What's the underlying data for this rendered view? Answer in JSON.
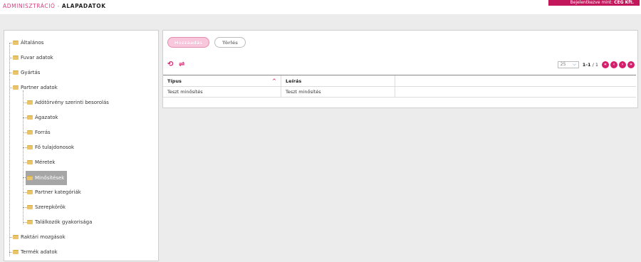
{
  "header": {
    "crumb_admin": "ADMINISZTRÁCIÓ",
    "crumb_sep": "-",
    "crumb_current": "ALAPADATOK",
    "login_prefix": "Bejelentkezve mint:",
    "login_company": "CÉG Kft."
  },
  "tree": {
    "items": [
      {
        "label": "Általános"
      },
      {
        "label": "Fuvar adatok"
      },
      {
        "label": "Gyártás"
      },
      {
        "label": "Partner adatok"
      },
      {
        "label": "Adótörvény szerinti besorolás"
      },
      {
        "label": "Ágazatok"
      },
      {
        "label": "Forrás"
      },
      {
        "label": "Fő tulajdonosok"
      },
      {
        "label": "Méretek"
      },
      {
        "label": "Minősítések"
      },
      {
        "label": "Partner kategóriák"
      },
      {
        "label": "Szerepkörök"
      },
      {
        "label": "Találkozók gyakorisága"
      },
      {
        "label": "Raktári mozgások"
      },
      {
        "label": "Termék adatok"
      }
    ]
  },
  "toolbar": {
    "add_label": "Hozzáadás",
    "delete_label": "Törlés"
  },
  "icons": {
    "refresh": "refresh-icon",
    "swap": "swap-icon"
  },
  "pager": {
    "page_size": "25",
    "range": "1-1",
    "total": "/ 1"
  },
  "table": {
    "columns": [
      "Típus",
      "Leírás"
    ],
    "rows": [
      [
        "Teszt minősítés",
        "Teszt minősítés"
      ]
    ]
  },
  "colors": {
    "accent": "#d61f6c",
    "badge": "#c2185b"
  }
}
